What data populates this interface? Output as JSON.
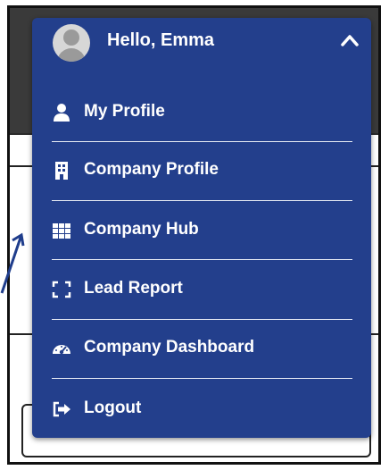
{
  "user_menu": {
    "greeting": "Hello, Emma",
    "items": [
      {
        "label": "My Profile",
        "icon": "user-icon"
      },
      {
        "label": "Company Profile",
        "icon": "building-icon"
      },
      {
        "label": "Company Hub",
        "icon": "grid-icon"
      },
      {
        "label": "Lead Report",
        "icon": "expand-icon"
      },
      {
        "label": "Company Dashboard",
        "icon": "dashboard-icon"
      },
      {
        "label": "Logout",
        "icon": "sign-out-icon"
      }
    ]
  },
  "colors": {
    "menu_background": "#233f8c",
    "text": "#ffffff",
    "separator": "#e8ecf5"
  }
}
